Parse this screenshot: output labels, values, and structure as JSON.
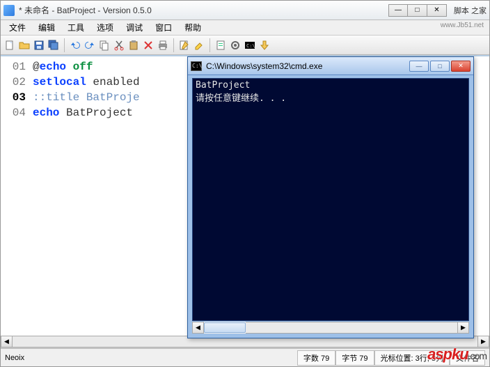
{
  "title": "* 未命名 - BatProject - Version 0.5.0",
  "brand": "脚本 之家",
  "brand_url": "www.Jb51.net",
  "menu": [
    "文件",
    "编辑",
    "工具",
    "选项",
    "调试",
    "窗口",
    "帮助"
  ],
  "toolbar_icons": [
    "new-file-icon",
    "open-folder-icon",
    "save-icon",
    "save-all-icon",
    "undo-icon",
    "redo-icon",
    "copy-icon",
    "cut-icon",
    "paste-icon",
    "delete-icon",
    "print-icon",
    "edit-icon",
    "highlight-icon",
    "report-icon",
    "options-icon",
    "run-cmd-icon",
    "execute-icon"
  ],
  "code": {
    "lines": [
      {
        "num": "01",
        "seg": [
          {
            "c": "txt",
            "t": "@"
          },
          {
            "c": "kwblue",
            "t": "echo"
          },
          {
            "c": "txt",
            "t": " "
          },
          {
            "c": "kwgreen",
            "t": "off"
          }
        ]
      },
      {
        "num": "02",
        "seg": [
          {
            "c": "kwblue",
            "t": "setlocal"
          },
          {
            "c": "txt",
            "t": " enabled"
          }
        ]
      },
      {
        "num": "03",
        "active": true,
        "seg": [
          {
            "c": "cmt",
            "t": "::title BatProje"
          }
        ]
      },
      {
        "num": "04",
        "seg": [
          {
            "c": "kwblue",
            "t": "echo"
          },
          {
            "c": "txt",
            "t": " BatProject"
          }
        ]
      }
    ]
  },
  "cmd": {
    "title": "C:\\Windows\\system32\\cmd.exe",
    "lines": [
      "BatProject",
      "请按任意键继续. . ."
    ]
  },
  "status": {
    "author": "Neoix",
    "wordcount_label": "字数",
    "wordcount": "79",
    "bytes_label": "字节",
    "bytes": "79",
    "cursor_label": "光标位置:",
    "cursor": "3行, 3列",
    "extra": "文件名"
  },
  "watermark": {
    "main": "aspku",
    "suf": ".com"
  },
  "winbtns": {
    "min": "—",
    "max": "□",
    "close": "✕"
  }
}
